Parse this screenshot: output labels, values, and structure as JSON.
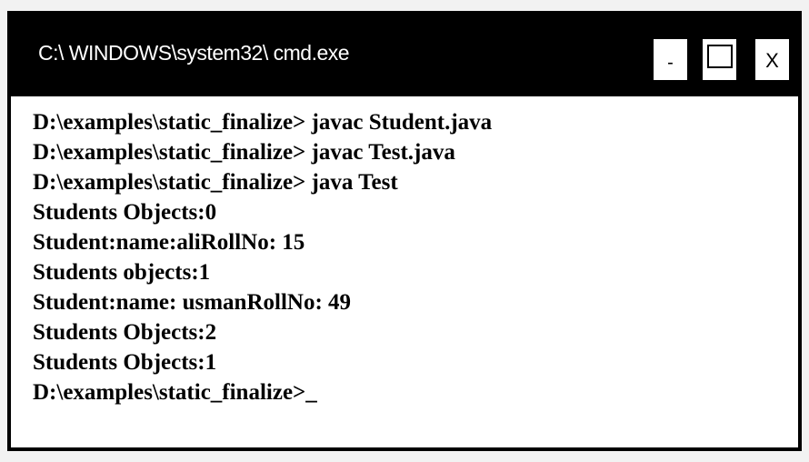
{
  "window": {
    "title": "C:\\ WINDOWS\\system32\\ cmd.exe",
    "controls": {
      "minimize": "-",
      "maximize": "☐",
      "close": "X"
    }
  },
  "console": {
    "lines": [
      "D:\\examples\\static_finalize> javac Student.java",
      "D:\\examples\\static_finalize> javac Test.java",
      "D:\\examples\\static_finalize> java Test",
      "Students Objects:0",
      "Student:name:aliRollNo: 15",
      "Students objects:1",
      "Student:name: usmanRollNo: 49",
      "Students Objects:2",
      "Students Objects:1",
      "D:\\examples\\static_finalize>_"
    ]
  }
}
